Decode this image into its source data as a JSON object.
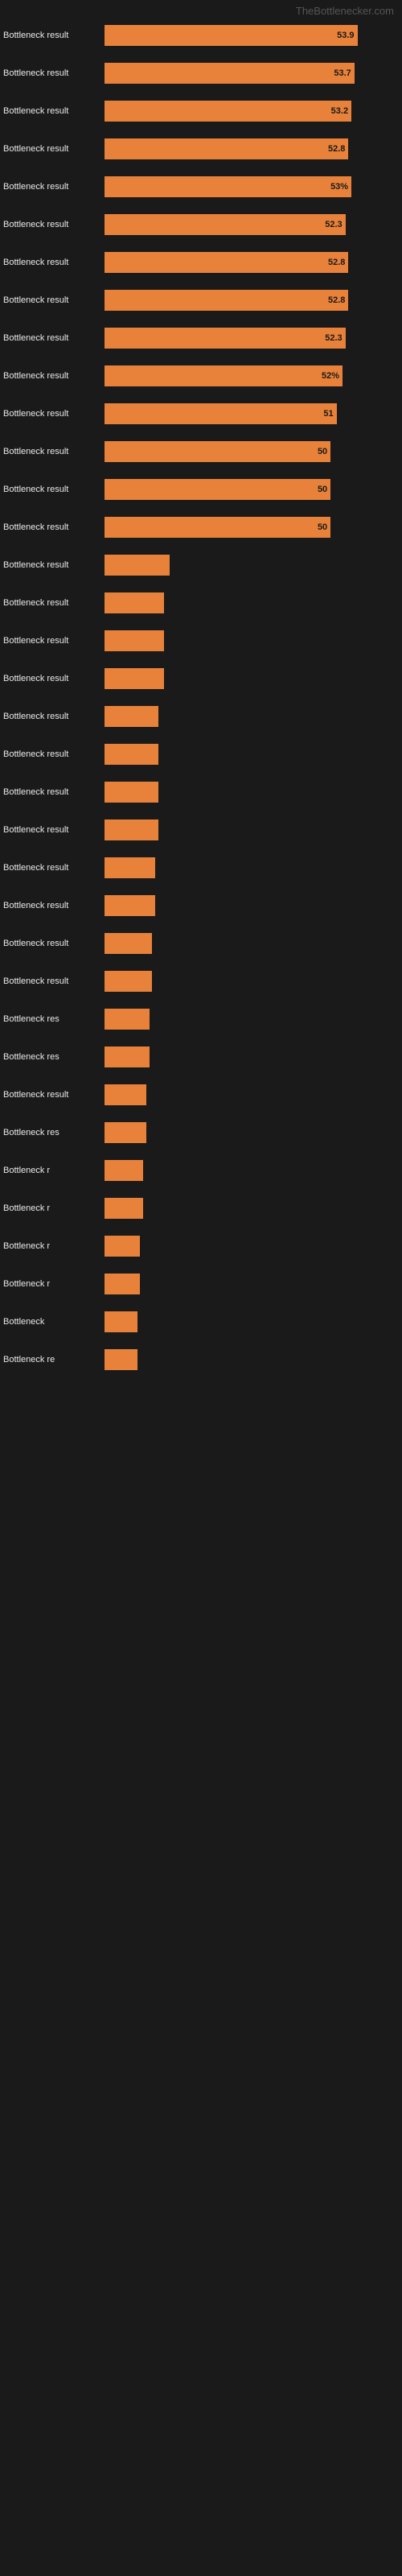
{
  "site_title": "TheBottlenecker.com",
  "bars": [
    {
      "label": "Bottleneck result",
      "value": "53.9",
      "width_pct": 85
    },
    {
      "label": "Bottleneck result",
      "value": "53.7",
      "width_pct": 84
    },
    {
      "label": "Bottleneck result",
      "value": "53.2",
      "width_pct": 83
    },
    {
      "label": "Bottleneck result",
      "value": "52.8",
      "width_pct": 82
    },
    {
      "label": "Bottleneck result",
      "value": "53%",
      "width_pct": 83
    },
    {
      "label": "Bottleneck result",
      "value": "52.3",
      "width_pct": 81
    },
    {
      "label": "Bottleneck result",
      "value": "52.8",
      "width_pct": 82
    },
    {
      "label": "Bottleneck result",
      "value": "52.8",
      "width_pct": 82
    },
    {
      "label": "Bottleneck result",
      "value": "52.3",
      "width_pct": 81
    },
    {
      "label": "Bottleneck result",
      "value": "52%",
      "width_pct": 80
    },
    {
      "label": "Bottleneck result",
      "value": "51",
      "width_pct": 78
    },
    {
      "label": "Bottleneck result",
      "value": "50",
      "width_pct": 76
    },
    {
      "label": "Bottleneck result",
      "value": "50",
      "width_pct": 76
    },
    {
      "label": "Bottleneck result",
      "value": "50",
      "width_pct": 76
    },
    {
      "label": "Bottleneck result",
      "value": "",
      "width_pct": 22
    },
    {
      "label": "Bottleneck result",
      "value": "",
      "width_pct": 20
    },
    {
      "label": "Bottleneck result",
      "value": "",
      "width_pct": 20
    },
    {
      "label": "Bottleneck result",
      "value": "",
      "width_pct": 20
    },
    {
      "label": "Bottleneck result",
      "value": "",
      "width_pct": 18
    },
    {
      "label": "Bottleneck result",
      "value": "",
      "width_pct": 18
    },
    {
      "label": "Bottleneck result",
      "value": "",
      "width_pct": 18
    },
    {
      "label": "Bottleneck result",
      "value": "",
      "width_pct": 18
    },
    {
      "label": "Bottleneck result",
      "value": "",
      "width_pct": 17
    },
    {
      "label": "Bottleneck result",
      "value": "",
      "width_pct": 17
    },
    {
      "label": "Bottleneck result",
      "value": "",
      "width_pct": 16
    },
    {
      "label": "Bottleneck result",
      "value": "",
      "width_pct": 16
    },
    {
      "label": "Bottleneck res",
      "value": "",
      "width_pct": 15
    },
    {
      "label": "Bottleneck res",
      "value": "",
      "width_pct": 15
    },
    {
      "label": "Bottleneck result",
      "value": "",
      "width_pct": 14
    },
    {
      "label": "Bottleneck res",
      "value": "",
      "width_pct": 14
    },
    {
      "label": "Bottleneck r",
      "value": "",
      "width_pct": 13
    },
    {
      "label": "Bottleneck r",
      "value": "",
      "width_pct": 13
    },
    {
      "label": "Bottleneck r",
      "value": "",
      "width_pct": 12
    },
    {
      "label": "Bottleneck r",
      "value": "",
      "width_pct": 12
    },
    {
      "label": "Bottleneck",
      "value": "",
      "width_pct": 11
    },
    {
      "label": "Bottleneck re",
      "value": "",
      "width_pct": 11
    }
  ]
}
